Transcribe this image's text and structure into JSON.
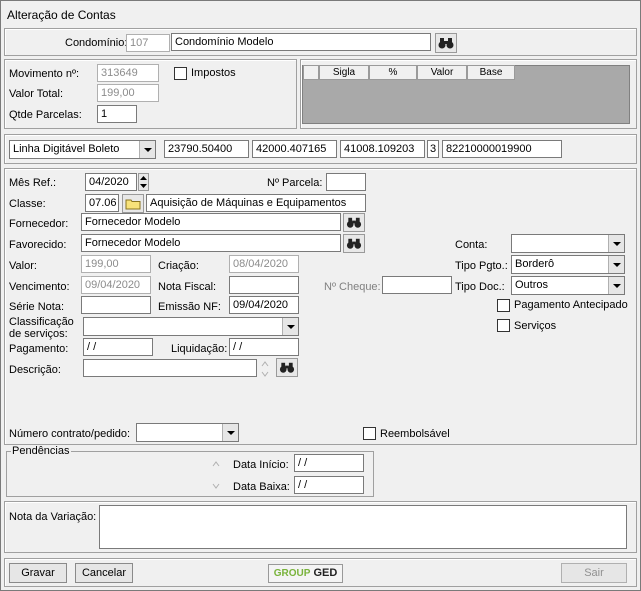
{
  "window": {
    "title": "Alteração de Contas"
  },
  "header": {
    "condominio_label": "Condomínio:",
    "condominio_code": "107",
    "condominio_name": "Condomínio Modelo"
  },
  "movement": {
    "movimento_label": "Movimento nº:",
    "movimento_value": "313649",
    "valor_total_label": "Valor Total:",
    "valor_total_value": "199,00",
    "qtde_parcelas_label": "Qtde Parcelas:",
    "qtde_parcelas_value": "1",
    "impostos_label": "Impostos"
  },
  "tax_grid": {
    "columns": [
      "Sigla",
      "%",
      "Valor",
      "Base"
    ]
  },
  "barcode": {
    "type": "Linha Digitável Boleto",
    "fields": [
      "23790.50400",
      "42000.407165",
      "41008.109203",
      "3",
      "82210000019900"
    ]
  },
  "details": {
    "mes_ref_label": "Mês Ref.:",
    "mes_ref_value": "04/2020",
    "num_parcela_label": "Nº Parcela:",
    "num_parcela_value": "",
    "classe_label": "Classe:",
    "classe_code": "07.06",
    "classe_name": "Aquisição de Máquinas e Equipamentos",
    "fornecedor_label": "Fornecedor:",
    "fornecedor_value": "Fornecedor Modelo",
    "favorecido_label": "Favorecido:",
    "favorecido_value": "Fornecedor Modelo",
    "conta_label": "Conta:",
    "conta_value": "",
    "valor_label": "Valor:",
    "valor_value": "199,00",
    "criacao_label": "Criação:",
    "criacao_value": "08/04/2020",
    "tipo_pgto_label": "Tipo Pgto.:",
    "tipo_pgto_value": "Borderô",
    "vencimento_label": "Vencimento:",
    "vencimento_value": "09/04/2020",
    "nota_fiscal_label": "Nota Fiscal:",
    "nota_fiscal_value": "",
    "num_cheque_label": "Nº Cheque:",
    "num_cheque_value": "",
    "tipo_doc_label": "Tipo Doc.:",
    "tipo_doc_value": "Outros",
    "serie_nota_label": "Série Nota:",
    "serie_nota_value": "",
    "emissao_nf_label": "Emissão NF:",
    "emissao_nf_value": "09/04/2020",
    "pagamento_antecipado_label": "Pagamento Antecipado",
    "classificacao_label_1": "Classificação",
    "classificacao_label_2": "de serviços:",
    "classificacao_value": "",
    "servicos_label": "Serviços",
    "pagamento_label": "Pagamento:",
    "pagamento_value": " / /",
    "liquidacao_label": "Liquidação:",
    "liquidacao_value": " / /",
    "descricao_label": "Descrição:",
    "descricao_value": "",
    "numero_contrato_label": "Número contrato/pedido:",
    "numero_contrato_value": "",
    "reembolsavel_label": "Reembolsável"
  },
  "pendencias": {
    "legend": "Pendências",
    "data_inicio_label": "Data Início:",
    "data_inicio_value": " / /",
    "data_baixa_label": "Data Baixa:",
    "data_baixa_value": " / /"
  },
  "nota_variacao": {
    "label": "Nota da Variação:",
    "value": ""
  },
  "footer": {
    "gravar_label": "Gravar",
    "cancelar_label": "Cancelar",
    "logo_text_1": "GROUP",
    "logo_text_2": "GED",
    "sair_label": "Sair"
  }
}
